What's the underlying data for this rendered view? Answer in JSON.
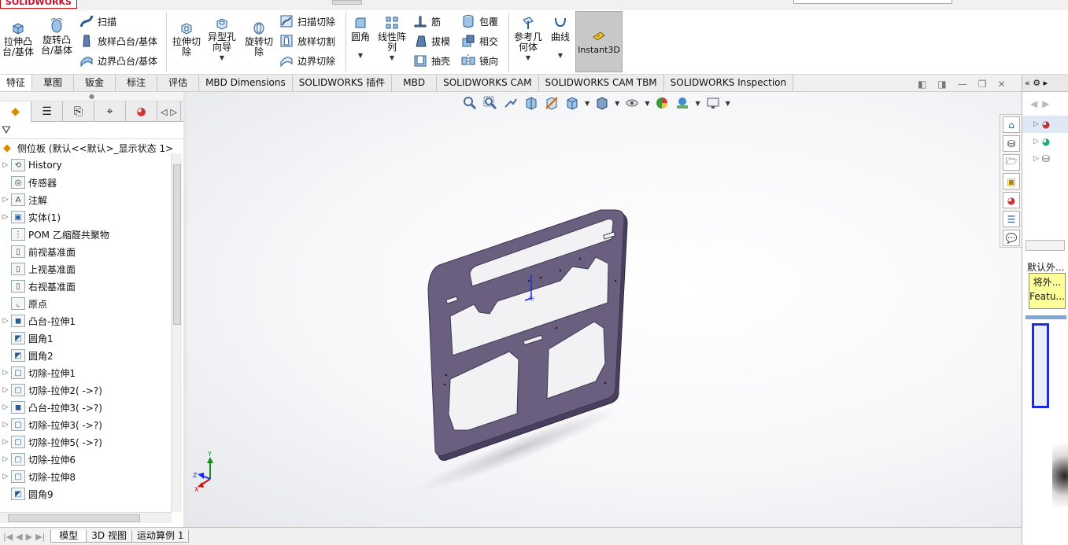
{
  "app": {
    "logo_text": "SOLIDWORKS"
  },
  "ribbon": {
    "extrude_boss": "拉伸凸\n台/基体",
    "revolve_boss": "旋转凸\n台/基体",
    "sweep": "扫描",
    "loft_boss": "放样凸台/基体",
    "boundary_boss": "边界凸台/基体",
    "extrude_cut": "拉伸切\n除",
    "hole_wizard": "异型孔\n向导",
    "revolve_cut": "旋转切\n除",
    "swept_cut": "扫描切除",
    "lofted_cut": "放样切割",
    "boundary_cut": "边界切除",
    "fillet": "圆角",
    "linear_pattern": "线性阵\n列",
    "rib": "筋",
    "draft": "拔模",
    "shell": "抽壳",
    "wrap": "包覆",
    "intersect": "相交",
    "mirror": "镜向",
    "ref_geometry": "参考几\n何体",
    "curves": "曲线",
    "instant3d": "Instant3D"
  },
  "tabs": [
    "特征",
    "草图",
    "钣金",
    "标注",
    "评估",
    "MBD Dimensions",
    "SOLIDWORKS 插件",
    "MBD",
    "SOLIDWORKS CAM",
    "SOLIDWORKS CAM TBM",
    "SOLIDWORKS Inspection"
  ],
  "tree": {
    "root": "侧位板  (默认<<默认>_显示状态 1>",
    "items": [
      {
        "label": "History",
        "icon": "history-icon",
        "exp": true
      },
      {
        "label": "传感器",
        "icon": "sensor-icon",
        "exp": false
      },
      {
        "label": "注解",
        "icon": "annotation-icon",
        "exp": true
      },
      {
        "label": "实体(1)",
        "icon": "solid-bodies-icon",
        "exp": true
      },
      {
        "label": "POM 乙缩醛共聚物",
        "icon": "material-icon",
        "exp": false
      },
      {
        "label": "前视基准面",
        "icon": "plane-icon",
        "exp": false
      },
      {
        "label": "上视基准面",
        "icon": "plane-icon",
        "exp": false
      },
      {
        "label": "右视基准面",
        "icon": "plane-icon",
        "exp": false
      },
      {
        "label": "原点",
        "icon": "origin-icon",
        "exp": false
      },
      {
        "label": "凸台-拉伸1",
        "icon": "boss-extrude-icon",
        "exp": true
      },
      {
        "label": "圆角1",
        "icon": "fillet-icon",
        "exp": false
      },
      {
        "label": "圆角2",
        "icon": "fillet-icon",
        "exp": false
      },
      {
        "label": "切除-拉伸1",
        "icon": "cut-extrude-icon",
        "exp": true
      },
      {
        "label": "切除-拉伸2( ->?)",
        "icon": "cut-extrude-icon",
        "exp": true
      },
      {
        "label": "凸台-拉伸3( ->?)",
        "icon": "boss-extrude-icon",
        "exp": true
      },
      {
        "label": "切除-拉伸3( ->?)",
        "icon": "cut-extrude-icon",
        "exp": true
      },
      {
        "label": "切除-拉伸5( ->?)",
        "icon": "cut-extrude-icon",
        "exp": true
      },
      {
        "label": "切除-拉伸6",
        "icon": "cut-extrude-icon",
        "exp": true
      },
      {
        "label": "切除-拉伸8",
        "icon": "cut-extrude-icon",
        "exp": true
      },
      {
        "label": "圆角9",
        "icon": "fillet-icon",
        "exp": false
      }
    ]
  },
  "bottom_tabs": [
    "模型",
    "3D 视图",
    "运动算例 1"
  ],
  "right_panel": {
    "label": "默认外...",
    "tooltip_line1": "将外...",
    "tooltip_line2": "Featu..."
  },
  "colors": {
    "part": "#6b5f80",
    "part_edge": "#3d3550",
    "accent": "#1f5fbf"
  }
}
